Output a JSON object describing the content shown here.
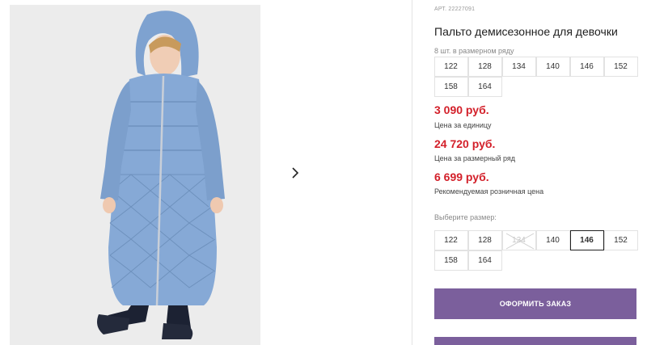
{
  "product": {
    "article": "АРТ. 22227091",
    "title": "Пальто демисезонное для девочки",
    "pack_note": "8 шт. в размерном ряду"
  },
  "size_row": [
    "122",
    "128",
    "134",
    "140",
    "146",
    "152",
    "158",
    "164"
  ],
  "prices": [
    {
      "value": "3 090 руб.",
      "label": "Цена за единицу"
    },
    {
      "value": "24 720 руб.",
      "label": "Цена за размерный ряд"
    },
    {
      "value": "6 699 руб.",
      "label": "Рекомендуемая розничная цена"
    }
  ],
  "size_picker": {
    "label": "Выберите размер:",
    "sizes": [
      "122",
      "128",
      "134",
      "140",
      "146",
      "152",
      "158",
      "164"
    ],
    "selected": "146",
    "unavailable": [
      "134"
    ]
  },
  "actions": {
    "order_label": "ОФОРМИТЬ ЗАКАЗ"
  },
  "colors": {
    "accent": "#7b5f9c",
    "price": "#d3202a"
  },
  "icons": {
    "next": "chevron-right-icon"
  }
}
